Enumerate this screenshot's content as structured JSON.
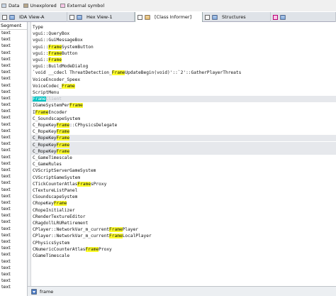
{
  "legend": [
    {
      "label": "Data",
      "color": "#c9d6e6"
    },
    {
      "label": "Unexplored",
      "color": "#b9a88a"
    },
    {
      "label": "External symbol",
      "color": "#f7c6e6"
    }
  ],
  "tabs": [
    {
      "label": "IDA View-A",
      "active": false
    },
    {
      "label": "Hex View-1",
      "active": false
    },
    {
      "label": "[Class Informer]",
      "active": true
    },
    {
      "label": "Structures",
      "active": false
    },
    {
      "label": "",
      "active": false
    }
  ],
  "segments": {
    "header": "Segment",
    "rows": [
      "text",
      "text",
      "text",
      "text",
      "text",
      "text",
      "text",
      "text",
      "text",
      "text",
      "text",
      "text",
      "text",
      "text",
      "text",
      "text",
      "text",
      "text",
      "text",
      "text",
      "text",
      "text",
      "text",
      "text",
      "text",
      "text",
      "text",
      "text",
      "text",
      "text",
      "text",
      "text",
      "text",
      "text",
      "text",
      "text",
      "text",
      "text",
      "text",
      "text"
    ]
  },
  "column_header": "Type",
  "rows": [
    {
      "parts": [
        {
          "t": "vgui::QueryBox"
        }
      ]
    },
    {
      "parts": [
        {
          "t": "vgui::GuiMessageBox"
        }
      ]
    },
    {
      "parts": [
        {
          "t": "vgui::"
        },
        {
          "t": "Frame",
          "h": "yellow"
        },
        {
          "t": "SystemButton"
        }
      ]
    },
    {
      "parts": [
        {
          "t": "vgui::"
        },
        {
          "t": "Frame",
          "h": "yellow"
        },
        {
          "t": "Button"
        }
      ]
    },
    {
      "parts": [
        {
          "t": "vgui::"
        },
        {
          "t": "Frame",
          "h": "yellow"
        }
      ]
    },
    {
      "parts": [
        {
          "t": "vgui::BuildModeDialog"
        }
      ]
    },
    {
      "parts": [
        {
          "t": "`void __cdecl ThreatDetection_"
        },
        {
          "t": "Frame",
          "h": "yellow"
        },
        {
          "t": "UpdateBegin(void)'::`2'::GatherPlayerThreats"
        }
      ]
    },
    {
      "parts": [
        {
          "t": "VoiceEncoder_Speex"
        }
      ]
    },
    {
      "parts": [
        {
          "t": "VoiceCodec_"
        },
        {
          "t": "Frame",
          "h": "yellow"
        }
      ]
    },
    {
      "parts": [
        {
          "t": "ScriptMenu"
        }
      ]
    },
    {
      "parts": [
        {
          "t": "      "
        },
        {
          "t": "Frame",
          "h": "cyan"
        },
        {
          "t": "Client",
          "ghost": true
        }
      ],
      "sel": true
    },
    {
      "parts": [
        {
          "t": "IGameSystemPer"
        },
        {
          "t": "Frame",
          "h": "yellow"
        }
      ]
    },
    {
      "parts": [
        {
          "t": "I"
        },
        {
          "t": "Frame",
          "h": "yellow"
        },
        {
          "t": "Encoder"
        }
      ]
    },
    {
      "parts": [
        {
          "t": "C_SoundscapeSystem"
        }
      ]
    },
    {
      "parts": [
        {
          "t": "C_RopeKey"
        },
        {
          "t": "Frame",
          "h": "yellow"
        },
        {
          "t": "::CPhysicsDelegate"
        }
      ]
    },
    {
      "parts": [
        {
          "t": "C_RopeKey"
        },
        {
          "t": "Frame",
          "h": "yellow"
        }
      ]
    },
    {
      "parts": [
        {
          "t": "C_RopeKey"
        },
        {
          "t": "Frame",
          "h": "yellow"
        }
      ],
      "sel": true
    },
    {
      "parts": [
        {
          "t": "C_RopeKey"
        },
        {
          "t": "Frame",
          "h": "yellow"
        }
      ],
      "sel": true
    },
    {
      "parts": [
        {
          "t": "C_RopeKey"
        },
        {
          "t": "Frame",
          "h": "yellow"
        }
      ],
      "sel": true
    },
    {
      "parts": [
        {
          "t": "C_GameTimescale"
        }
      ]
    },
    {
      "parts": [
        {
          "t": "C_GameRules"
        }
      ]
    },
    {
      "parts": [
        {
          "t": "CVScriptServerGameSystem"
        }
      ]
    },
    {
      "parts": [
        {
          "t": "CVScriptGameSystem"
        }
      ]
    },
    {
      "parts": [
        {
          "t": "CTickCounterAtlas"
        },
        {
          "t": "Frame",
          "h": "yellow"
        },
        {
          "t": "sProxy"
        }
      ]
    },
    {
      "parts": [
        {
          "t": "CTextureListPanel"
        }
      ]
    },
    {
      "parts": [
        {
          "t": "CSoundscapeSystem"
        }
      ]
    },
    {
      "parts": [
        {
          "t": "CRopeKey"
        },
        {
          "t": "Frame",
          "h": "yellow"
        }
      ]
    },
    {
      "parts": [
        {
          "t": "CRopeInitializer"
        }
      ]
    },
    {
      "parts": [
        {
          "t": "CRenderTextureEditor"
        }
      ]
    },
    {
      "parts": [
        {
          "t": "CRagdollLRURetirement"
        }
      ]
    },
    {
      "parts": [
        {
          "t": "CPlayer::NetworkVar_m_current"
        },
        {
          "t": "Frame",
          "h": "yellow"
        },
        {
          "t": "Player"
        }
      ]
    },
    {
      "parts": [
        {
          "t": "CPlayer::NetworkVar_m_current"
        },
        {
          "t": "Frame",
          "h": "yellow"
        },
        {
          "t": "LocalPlayer"
        }
      ]
    },
    {
      "parts": [
        {
          "t": "CPhysicsSystem"
        }
      ]
    },
    {
      "parts": [
        {
          "t": "CNumericCounterAtlas"
        },
        {
          "t": "Frame",
          "h": "yellow"
        },
        {
          "t": "Proxy"
        }
      ]
    },
    {
      "parts": [
        {
          "t": "CGameTimescale"
        }
      ]
    }
  ],
  "search": {
    "value": "frame",
    "icon": "filter-icon"
  },
  "colors": {
    "highlight": "#ffff2a",
    "match_current": "#00c2c2",
    "selection": "#e6e8ec"
  }
}
